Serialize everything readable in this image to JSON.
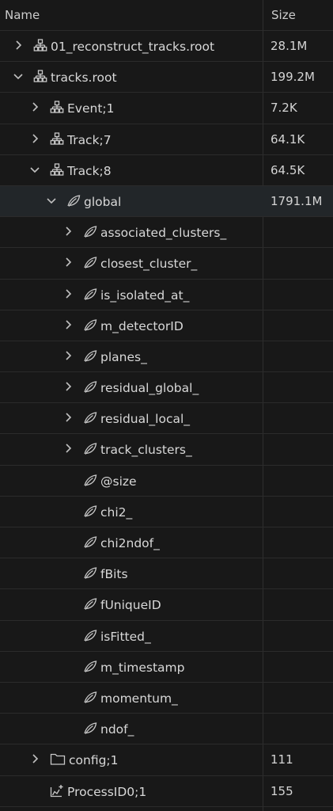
{
  "header": {
    "name": "Name",
    "size": "Size"
  },
  "rows": [
    {
      "name": "01_reconstruct_tracks.root",
      "size": "28.1M",
      "depth": 1,
      "chevron": "right",
      "icon": "tree-icon"
    },
    {
      "name": "tracks.root",
      "size": "199.2M",
      "depth": 1,
      "chevron": "down",
      "icon": "tree-icon"
    },
    {
      "name": "Event;1",
      "size": "7.2K",
      "depth": 2,
      "chevron": "right",
      "icon": "tree-icon"
    },
    {
      "name": "Track;7",
      "size": "64.1K",
      "depth": 2,
      "chevron": "right",
      "icon": "tree-icon"
    },
    {
      "name": "Track;8",
      "size": "64.5K",
      "depth": 2,
      "chevron": "down",
      "icon": "tree-icon"
    },
    {
      "name": "global",
      "size": "1791.1M",
      "depth": 3,
      "chevron": "down",
      "icon": "leaf-icon",
      "selected": true
    },
    {
      "name": "associated_clusters_",
      "size": "",
      "depth": 4,
      "chevron": "right",
      "icon": "leaf-icon"
    },
    {
      "name": "closest_cluster_",
      "size": "",
      "depth": 4,
      "chevron": "right",
      "icon": "leaf-icon"
    },
    {
      "name": "is_isolated_at_",
      "size": "",
      "depth": 4,
      "chevron": "right",
      "icon": "leaf-icon"
    },
    {
      "name": "m_detectorID",
      "size": "",
      "depth": 4,
      "chevron": "right",
      "icon": "leaf-icon"
    },
    {
      "name": "planes_",
      "size": "",
      "depth": 4,
      "chevron": "right",
      "icon": "leaf-icon"
    },
    {
      "name": "residual_global_",
      "size": "",
      "depth": 4,
      "chevron": "right",
      "icon": "leaf-icon"
    },
    {
      "name": "residual_local_",
      "size": "",
      "depth": 4,
      "chevron": "right",
      "icon": "leaf-icon"
    },
    {
      "name": "track_clusters_",
      "size": "",
      "depth": 4,
      "chevron": "right",
      "icon": "leaf-icon"
    },
    {
      "name": "@size",
      "size": "",
      "depth": 4,
      "chevron": "none",
      "icon": "leaf-icon"
    },
    {
      "name": "chi2_",
      "size": "",
      "depth": 4,
      "chevron": "none",
      "icon": "leaf-icon"
    },
    {
      "name": "chi2ndof_",
      "size": "",
      "depth": 4,
      "chevron": "none",
      "icon": "leaf-icon"
    },
    {
      "name": "fBits",
      "size": "",
      "depth": 4,
      "chevron": "none",
      "icon": "leaf-icon"
    },
    {
      "name": "fUniqueID",
      "size": "",
      "depth": 4,
      "chevron": "none",
      "icon": "leaf-icon"
    },
    {
      "name": "isFitted_",
      "size": "",
      "depth": 4,
      "chevron": "none",
      "icon": "leaf-icon"
    },
    {
      "name": "m_timestamp",
      "size": "",
      "depth": 4,
      "chevron": "none",
      "icon": "leaf-icon"
    },
    {
      "name": "momentum_",
      "size": "",
      "depth": 4,
      "chevron": "none",
      "icon": "leaf-icon"
    },
    {
      "name": "ndof_",
      "size": "",
      "depth": 4,
      "chevron": "none",
      "icon": "leaf-icon"
    },
    {
      "name": "config;1",
      "size": "111",
      "depth": 2,
      "chevron": "right",
      "icon": "folder-icon"
    },
    {
      "name": "ProcessID0;1",
      "size": "155",
      "depth": 2,
      "chevron": "none",
      "icon": "histogram-icon"
    }
  ],
  "colors": {
    "background": "#181818",
    "selected_row": "#222629",
    "text": "#d8d8d8",
    "icon": "#c8c8c8"
  }
}
